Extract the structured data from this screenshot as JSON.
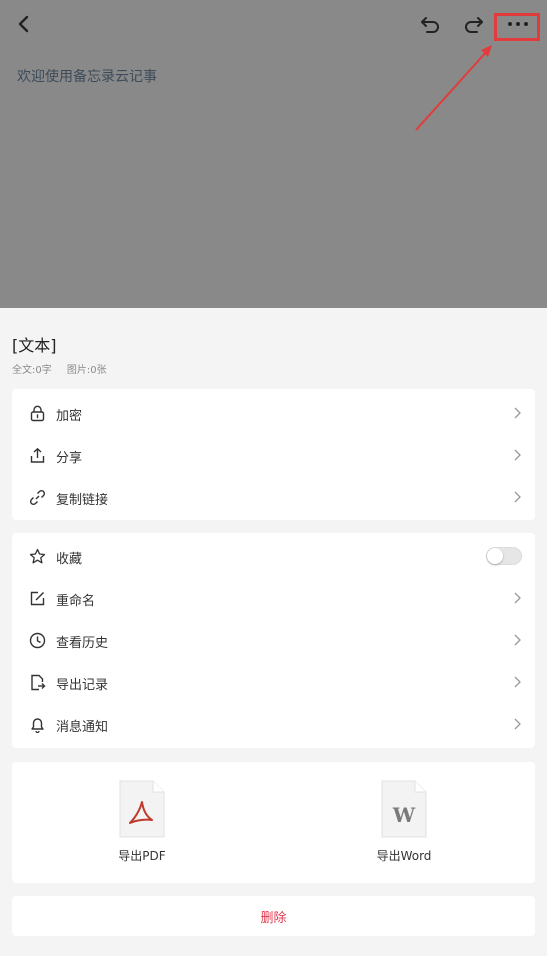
{
  "editor": {
    "placeholder_text": "欢迎使用备忘录云记事"
  },
  "icons": {
    "back": "back-arrow-icon",
    "undo": "undo-icon",
    "redo": "redo-icon",
    "more": "more-dots-icon"
  },
  "sheet": {
    "title": "[文本]",
    "stats": {
      "chars": "全文:0字",
      "images": "图片:0张"
    }
  },
  "menu_group_1": [
    {
      "label": "加密",
      "icon": "lock-icon"
    },
    {
      "label": "分享",
      "icon": "share-icon"
    },
    {
      "label": "复制链接",
      "icon": "link-icon"
    }
  ],
  "menu_group_2": [
    {
      "label": "收藏",
      "icon": "star-icon",
      "toggle": false
    },
    {
      "label": "重命名",
      "icon": "rename-icon"
    },
    {
      "label": "查看历史",
      "icon": "history-clock-icon"
    },
    {
      "label": "导出记录",
      "icon": "export-record-icon"
    },
    {
      "label": "消息通知",
      "icon": "bell-icon"
    }
  ],
  "export_options": [
    {
      "label": "导出PDF",
      "icon": "pdf-file-icon"
    },
    {
      "label": "导出Word",
      "icon": "word-file-icon"
    }
  ],
  "delete_label": "删除",
  "colors": {
    "highlight_red": "#e23b3b",
    "delete_red": "#e0384f",
    "overlay": "#898989"
  }
}
